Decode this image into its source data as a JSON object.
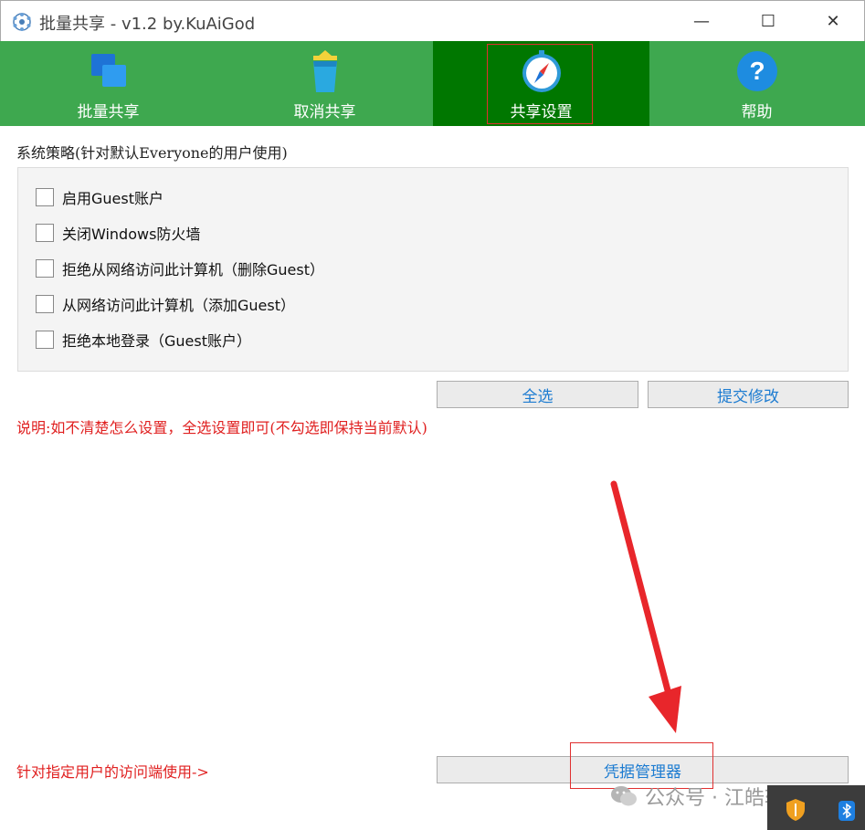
{
  "window": {
    "title": "批量共享 - v1.2 by.KuAiGod",
    "minimize_glyph": "—",
    "maximize_glyph": "☐",
    "close_glyph": "✕"
  },
  "toolbar": {
    "items": [
      {
        "label": "批量共享",
        "icon": "windows-share-icon"
      },
      {
        "label": "取消共享",
        "icon": "recycle-bin-icon"
      },
      {
        "label": "共享设置",
        "icon": "compass-icon"
      },
      {
        "label": "帮助",
        "icon": "help-icon"
      }
    ],
    "active_index": 2,
    "colors": {
      "bar": "#3ea84f",
      "active": "#007700"
    }
  },
  "policy": {
    "section_label": "系统策略(针对默认Everyone的用户使用)",
    "options": [
      {
        "label": "启用Guest账户",
        "checked": false
      },
      {
        "label": "关闭Windows防火墙",
        "checked": false
      },
      {
        "label": "拒绝从网络访问此计算机（删除Guest）",
        "checked": false
      },
      {
        "label": "从网络访问此计算机（添加Guest）",
        "checked": false
      },
      {
        "label": "拒绝本地登录（Guest账户）",
        "checked": false
      }
    ],
    "select_all_label": "全选",
    "submit_label": "提交修改",
    "note": "说明:如不清楚怎么设置，全选设置即可(不勾选即保持当前默认)"
  },
  "footer": {
    "hint": "针对指定用户的访问端使用->",
    "credential_manager_label": "凭据管理器"
  },
  "watermark": {
    "text": "公众号 · 江皓软件"
  },
  "accent_colors": {
    "button_text": "#1d7cd1",
    "note_text": "#e02020",
    "annotation": "#e03030"
  }
}
